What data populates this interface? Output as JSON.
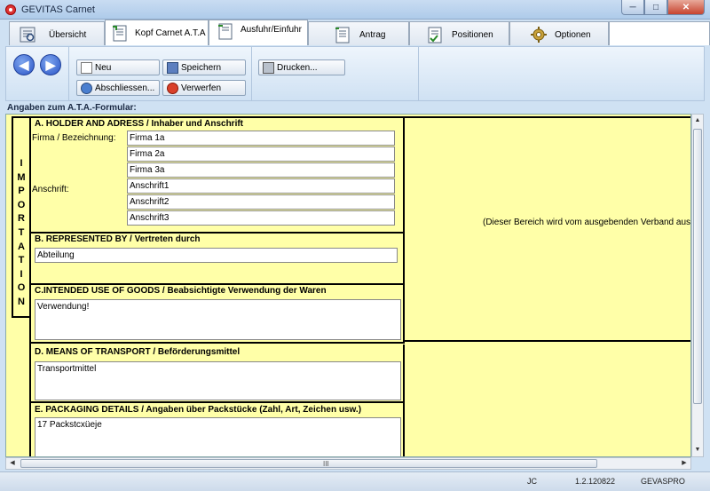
{
  "window": {
    "title": "GEVITAS Carnet",
    "controls": {
      "minimize": "─",
      "maximize": "□",
      "close": "✕"
    }
  },
  "tabs": [
    {
      "label": "Übersicht",
      "icon": "overview-icon",
      "active": false
    },
    {
      "label": "Kopf Carnet A.T.A",
      "icon": "document-icon",
      "active": true
    },
    {
      "label": "Ausfuhr/Einfuhr",
      "icon": "export-import-icon",
      "active": false
    },
    {
      "label": "Antrag",
      "icon": "application-icon",
      "active": false
    },
    {
      "label": "Positionen",
      "icon": "positions-icon",
      "active": false
    },
    {
      "label": "Optionen",
      "icon": "gear-icon",
      "active": false
    }
  ],
  "toolbar": {
    "back": "◀",
    "forward": "▶",
    "new_label": "Neu",
    "save_label": "Speichern",
    "print_label": "Drucken...",
    "finish_label": "Abschliessen...",
    "discard_label": "Verwerfen"
  },
  "section_label": "Angaben zum A.T.A.-Formular:",
  "form": {
    "importation_label": "IMPORTATION",
    "importation_letters": [
      "I",
      "M",
      "P",
      "O",
      "R",
      "T",
      "A",
      "T",
      "I",
      "O",
      "N"
    ],
    "holder": {
      "title": "A. HOLDER AND ADRESS / Inhaber und Anschrift",
      "company_label": "Firma / Bezeichnung:",
      "company_lines": [
        "Firma 1a",
        "Firma 2a",
        "Firma 3a"
      ],
      "address_label": "Anschrift:",
      "address_lines": [
        "Anschrift1",
        "Anschrift2",
        "Anschrift3"
      ]
    },
    "represented": {
      "title": "B. REPRESENTED BY / Vertreten durch",
      "value": "Abteilung"
    },
    "intended_use": {
      "title": "C.INTENDED USE OF GOODS / Beabsichtigte Verwendung der Waren",
      "value": "Verwendung!"
    },
    "transport": {
      "title": "D. MEANS OF TRANSPORT / Beförderungsmittel",
      "value": "Transportmittel"
    },
    "packaging": {
      "title": "E. PACKAGING DETAILS / Angaben über Packstücke (Zahl, Art, Zeichen usw.)",
      "value": "17 Packstcxüeje"
    },
    "issuer_note": "(Dieser Bereich wird vom ausgebenden Verband ausge"
  },
  "scrollbar": {
    "grip": "III"
  },
  "status": {
    "user": "JC",
    "version": "1.2.120822",
    "system": "GEVASPRO"
  }
}
